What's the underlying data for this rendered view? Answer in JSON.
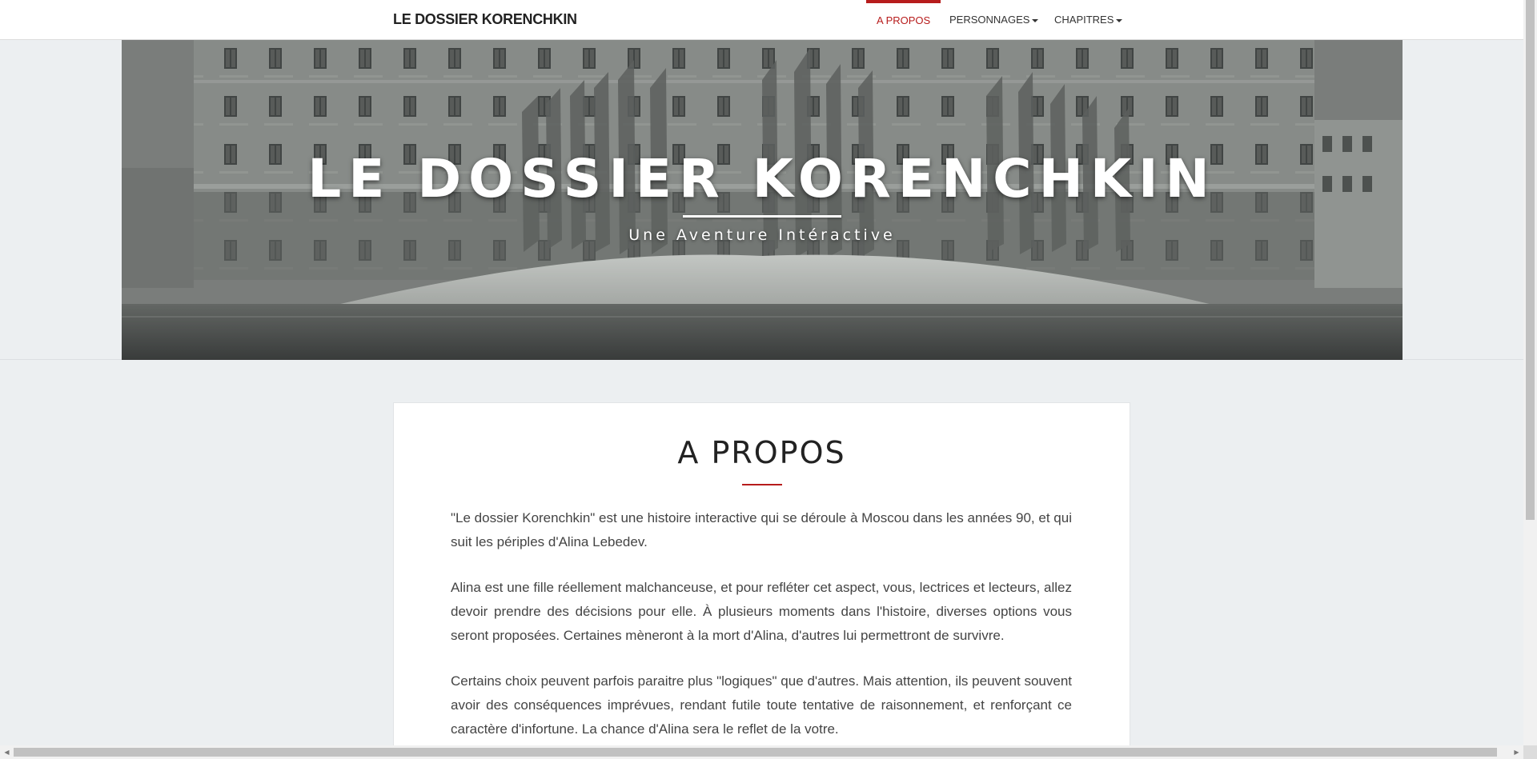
{
  "navbar": {
    "brand": "LE DOSSIER KORENCHKIN",
    "items": [
      {
        "label": "A PROPOS",
        "active": true,
        "dropdown": false
      },
      {
        "label": "PERSONNAGES",
        "active": false,
        "dropdown": true
      },
      {
        "label": "CHAPITRES",
        "active": false,
        "dropdown": true
      }
    ]
  },
  "hero": {
    "title": "LE DOSSIER KORENCHKIN",
    "subtitle": "Une Aventure Intéractive"
  },
  "about": {
    "heading": "A PROPOS",
    "paragraphs": [
      "\"Le dossier Korenchkin\" est une histoire interactive qui se déroule à Moscou dans les années 90, et qui suit les périples d'Alina Lebedev.",
      "Alina est une fille réellement malchanceuse, et pour refléter cet aspect, vous, lectrices et lecteurs, allez devoir prendre des décisions pour elle. À plusieurs moments dans l'histoire, diverses options vous seront proposées. Certaines mèneront à la mort d'Alina, d'autres lui permettront de survivre.",
      "Certains choix peuvent parfois paraitre plus \"logiques\" que d'autres. Mais attention, ils peuvent souvent avoir des conséquences imprévues, rendant futile toute tentative de raisonnement, et renforçant ce caractère d'infortune. La chance d'Alina sera le reflet de la votre."
    ]
  },
  "colors": {
    "accent": "#b71c1c",
    "background": "#eceff1",
    "card": "#ffffff",
    "text": "#444444"
  },
  "scrollbars": {
    "up_arrow": "▲",
    "down_arrow": "▼",
    "left_arrow": "◀",
    "right_arrow": "▶"
  }
}
